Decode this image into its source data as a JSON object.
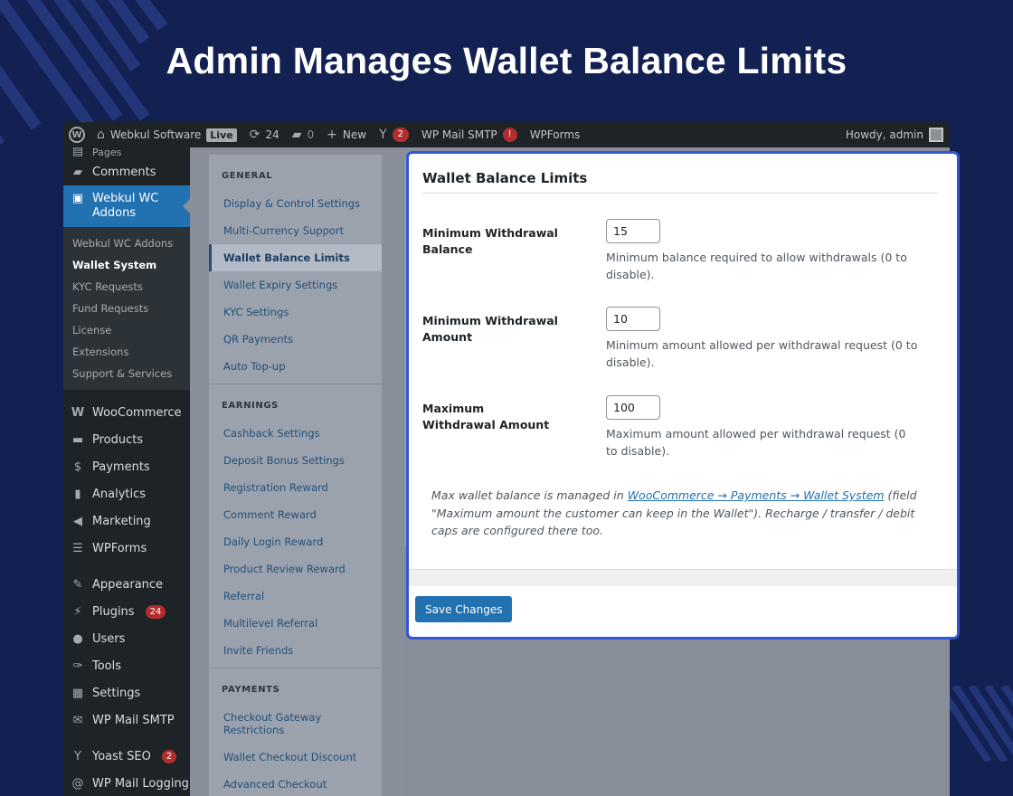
{
  "hero": {
    "title": "Admin Manages Wallet Balance Limits"
  },
  "adminbar": {
    "site_name": "Webkul Software",
    "live_label": "Live",
    "updates_count": "24",
    "comments_count": "0",
    "new_label": "New",
    "yoast_count": "2",
    "mail_smtp_label": "WP Mail SMTP",
    "mail_smtp_alert": "!",
    "wpforms_label": "WPForms",
    "howdy": "Howdy, admin"
  },
  "sidebar": {
    "top_items": [
      {
        "label": "Pages",
        "icon": "pages-icon"
      },
      {
        "label": "Comments",
        "icon": "comment-icon"
      }
    ],
    "active_item": "Webkul WC Addons",
    "submenu": [
      "Webkul WC Addons",
      "Wallet System",
      "KYC Requests",
      "Fund Requests",
      "License",
      "Extensions",
      "Support & Services"
    ],
    "submenu_current": "Wallet System",
    "items": [
      {
        "label": "WooCommerce",
        "icon": "woocommerce-icon"
      },
      {
        "label": "Products",
        "icon": "products-icon"
      },
      {
        "label": "Payments",
        "icon": "payments-icon"
      },
      {
        "label": "Analytics",
        "icon": "analytics-icon"
      },
      {
        "label": "Marketing",
        "icon": "megaphone-icon"
      },
      {
        "label": "WPForms",
        "icon": "wpforms-icon"
      },
      {
        "label": "Appearance",
        "icon": "brush-icon"
      },
      {
        "label": "Plugins",
        "icon": "plugin-icon",
        "badge": "24"
      },
      {
        "label": "Users",
        "icon": "users-icon"
      },
      {
        "label": "Tools",
        "icon": "wrench-icon"
      },
      {
        "label": "Settings",
        "icon": "settings-icon"
      },
      {
        "label": "WP Mail SMTP",
        "icon": "mail-icon"
      },
      {
        "label": "Yoast SEO",
        "icon": "yoast-icon",
        "badge": "2"
      },
      {
        "label": "WP Mail Logging",
        "icon": "at-icon"
      }
    ]
  },
  "subnav": {
    "sections": [
      {
        "heading": "GENERAL",
        "items": [
          "Display & Control Settings",
          "Multi-Currency Support",
          "Wallet Balance Limits",
          "Wallet Expiry Settings",
          "KYC Settings",
          "QR Payments",
          "Auto Top-up"
        ]
      },
      {
        "heading": "EARNINGS",
        "items": [
          "Cashback Settings",
          "Deposit Bonus Settings",
          "Registration Reward",
          "Comment Reward",
          "Daily Login Reward",
          "Product Review Reward",
          "Referral",
          "Multilevel Referral",
          "Invite Friends"
        ]
      },
      {
        "heading": "PAYMENTS",
        "items": [
          "Checkout Gateway Restrictions",
          "Wallet Checkout Discount",
          "Advanced Checkout"
        ]
      }
    ],
    "active": "Wallet Balance Limits"
  },
  "card": {
    "title": "Wallet Balance Limits",
    "fields": [
      {
        "label": "Minimum Withdrawal Balance",
        "value": "15",
        "desc": "Minimum balance required to allow withdrawals (0 to disable)."
      },
      {
        "label": "Minimum Withdrawal Amount",
        "value": "10",
        "desc": "Minimum amount allowed per withdrawal request (0 to disable)."
      },
      {
        "label": "Maximum Withdrawal Amount",
        "value": "100",
        "desc": "Maximum amount allowed per withdrawal request (0 to disable)."
      }
    ],
    "note_prefix": "Max wallet balance is managed in ",
    "note_link": "WooCommerce → Payments → Wallet System",
    "note_suffix": " (field \"Maximum amount the customer can keep in the Wallet\"). Recharge / transfer / debit caps are configured there too.",
    "save_label": "Save Changes"
  },
  "colors": {
    "background": "#132052",
    "accent": "#2271b1",
    "highlight_border": "#2f56d4"
  }
}
